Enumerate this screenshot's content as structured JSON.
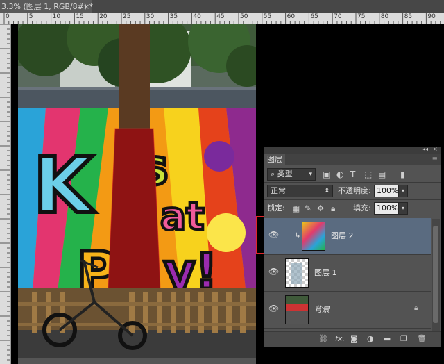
{
  "document_tab": {
    "title": "3.3% (图层 1, RGB/8#) *",
    "close_symbol": "×"
  },
  "ruler": {
    "numbers": [
      "0",
      "5",
      "10",
      "15",
      "20",
      "25",
      "30",
      "35",
      "40",
      "45",
      "50",
      "55",
      "60",
      "65",
      "70",
      "75",
      "80",
      "85",
      "90"
    ]
  },
  "layers_panel": {
    "tab_label": "图层",
    "collapse_symbol": "◂◂",
    "close_symbol": "×",
    "menu_symbol": "≡",
    "filter_kind": "类型",
    "blend_mode": "正常",
    "opacity_label": "不透明度:",
    "opacity_value": "100%",
    "lock_label": "锁定:",
    "fill_label": "填充:",
    "fill_value": "100%",
    "layers": [
      {
        "name": "图层 2",
        "selected": true,
        "visible": true
      },
      {
        "name": "图层 1",
        "selected": false,
        "visible": true
      },
      {
        "name": "背景",
        "selected": false,
        "visible": true,
        "locked": true
      }
    ],
    "bottom_fx_label": "fx."
  },
  "colors": {
    "selection_bg": "#5a6b80",
    "highlight_border": "#e0262a",
    "panel_bg": "#535353"
  }
}
